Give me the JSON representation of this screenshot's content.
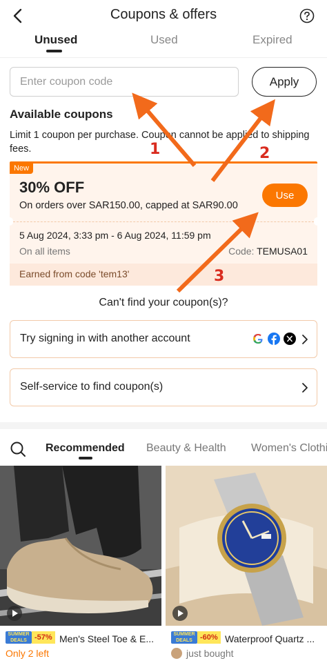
{
  "header": {
    "title": "Coupons & offers",
    "back_icon": "chevron-left-icon",
    "help_icon": "question-circle-icon"
  },
  "tabs": [
    {
      "label": "Unused",
      "active": true
    },
    {
      "label": "Used",
      "active": false
    },
    {
      "label": "Expired",
      "active": false
    }
  ],
  "coupon_entry": {
    "placeholder": "Enter coupon code",
    "value": "",
    "apply_label": "Apply"
  },
  "available": {
    "title": "Available coupons",
    "notice": "Limit 1 coupon per purchase. Coupon cannot be applied to shipping fees."
  },
  "coupon": {
    "badge": "New",
    "discount": "30% OFF",
    "condition": "On orders over SAR150.00, capped at SAR90.00",
    "use_label": "Use",
    "validity": "5 Aug 2024, 3:33 pm - 6 Aug 2024, 11:59 pm",
    "scope": "On all items",
    "code_label": "Code: ",
    "code_value": "TEMUSA01",
    "earned": "Earned from code 'tem13'"
  },
  "help_section": {
    "cant_find": "Can't find your coupon(s)?",
    "options": [
      {
        "label": "Try signing in with another account",
        "icons": [
          "google-icon",
          "facebook-icon",
          "x-icon"
        ]
      },
      {
        "label": "Self-service to find coupon(s)"
      }
    ]
  },
  "categories": {
    "items": [
      "Recommended",
      "Beauty & Health",
      "Women's Clothing"
    ],
    "active": "Recommended"
  },
  "products": [
    {
      "badge": "SUMMER DEALS",
      "discount": "-57%",
      "name": "Men's Steel Toe & E...",
      "status": "Only 2 left",
      "status_color": "#fb7701"
    },
    {
      "badge": "SUMMER DEALS",
      "discount": "-60%",
      "name": "Waterproof Quartz ...",
      "status": "just bought",
      "status_color": "#777777"
    }
  ],
  "annotations": [
    "1",
    "2",
    "3"
  ],
  "colors": {
    "accent": "#fb7701",
    "annotation": "#d92c1f",
    "arrow": "#f26a1b"
  }
}
